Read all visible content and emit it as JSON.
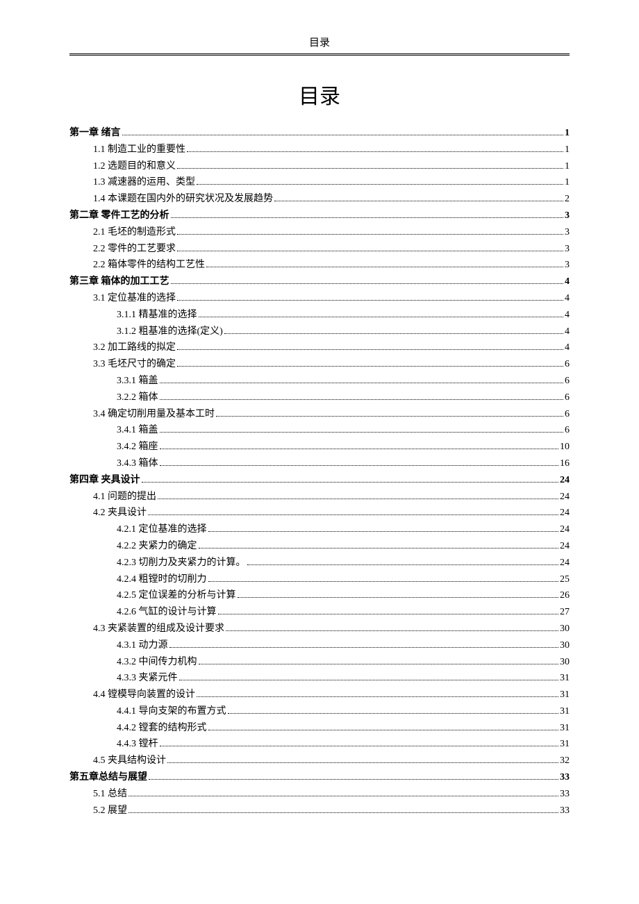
{
  "header": "目录",
  "title": "目录",
  "toc": [
    {
      "level": 0,
      "title": "第一章 绪言",
      "page": "1"
    },
    {
      "level": 1,
      "title": "1.1 制造工业的重要性",
      "page": "1"
    },
    {
      "level": 1,
      "title": "1.2 选题目的和意义",
      "page": "1"
    },
    {
      "level": 1,
      "title": "1.3  减速器的运用、类型",
      "page": "1"
    },
    {
      "level": 1,
      "title": "1.4 本课题在国内外的研究状况及发展趋势",
      "page": "2"
    },
    {
      "level": 0,
      "title": "第二章  零件工艺的分析",
      "page": "3"
    },
    {
      "level": 1,
      "title": "2.1 毛坯的制造形式",
      "page": "3"
    },
    {
      "level": 1,
      "title": "2.2 零件的工艺要求",
      "page": "3"
    },
    {
      "level": 1,
      "title": "2.2  箱体零件的结构工艺性",
      "page": "3"
    },
    {
      "level": 0,
      "title": "第三章  箱体的加工工艺",
      "page": "4"
    },
    {
      "level": 1,
      "title": "3.1 定位基准的选择",
      "page": "4"
    },
    {
      "level": 2,
      "title": "3.1.1  精基准的选择",
      "page": "4"
    },
    {
      "level": 2,
      "title": "3.1.2  粗基准的选择(定义)",
      "page": "4"
    },
    {
      "level": 1,
      "title": "3.2 加工路线的拟定",
      "page": "4"
    },
    {
      "level": 1,
      "title": "3.3 毛坯尺寸的确定",
      "page": "6"
    },
    {
      "level": 2,
      "title": "3.3.1 箱盖",
      "page": "6"
    },
    {
      "level": 2,
      "title": "3.2.2 箱体",
      "page": "6"
    },
    {
      "level": 1,
      "title": "3.4 确定切削用量及基本工时",
      "page": "6"
    },
    {
      "level": 2,
      "title": "3.4.1 箱盖",
      "page": "6"
    },
    {
      "level": 2,
      "title": "3.4.2 箱座",
      "page": "10"
    },
    {
      "level": 2,
      "title": "3.4.3 箱体",
      "page": "16"
    },
    {
      "level": 0,
      "title": "第四章    夹具设计",
      "page": "24"
    },
    {
      "level": 1,
      "title": "4.1 问题的提出",
      "page": "24"
    },
    {
      "level": 1,
      "title": "4.2 夹具设计",
      "page": "24"
    },
    {
      "level": 2,
      "title": "4.2.1  定位基准的选择",
      "page": "24"
    },
    {
      "level": 2,
      "title": "4.2.2 夹紧力的确定",
      "page": "24"
    },
    {
      "level": 2,
      "title": "4.2.3  切削力及夹紧力的计算。",
      "page": "24"
    },
    {
      "level": 2,
      "title": "4.2.4 粗镗时的切削力",
      "page": "25"
    },
    {
      "level": 2,
      "title": "4.2.5  定位误差的分析与计算",
      "page": "26"
    },
    {
      "level": 2,
      "title": "4.2.6 气缸的设计与计算",
      "page": "27"
    },
    {
      "level": 1,
      "title": "4.3 夹紧装置的组成及设计要求",
      "page": "30"
    },
    {
      "level": 2,
      "title": "4.3.1 动力源",
      "page": "30"
    },
    {
      "level": 2,
      "title": "4.3.2 中间传力机构",
      "page": "30"
    },
    {
      "level": 2,
      "title": "4.3.3 夹紧元件",
      "page": "31"
    },
    {
      "level": 1,
      "title": "4.4 镗模导向装置的设计",
      "page": "31"
    },
    {
      "level": 2,
      "title": "4.4.1 导向支架的布置方式",
      "page": "31"
    },
    {
      "level": 2,
      "title": "4.4.2 镗套的结构形式",
      "page": "31"
    },
    {
      "level": 2,
      "title": "4.4.3 镗杆",
      "page": "31"
    },
    {
      "level": 1,
      "title": "4.5 夹具结构设计",
      "page": "32"
    },
    {
      "level": 0,
      "title": "第五章总结与展望",
      "page": "33"
    },
    {
      "level": 1,
      "title": "5.1 总结",
      "page": "33"
    },
    {
      "level": 1,
      "title": "5.2 展望",
      "page": "33"
    }
  ]
}
